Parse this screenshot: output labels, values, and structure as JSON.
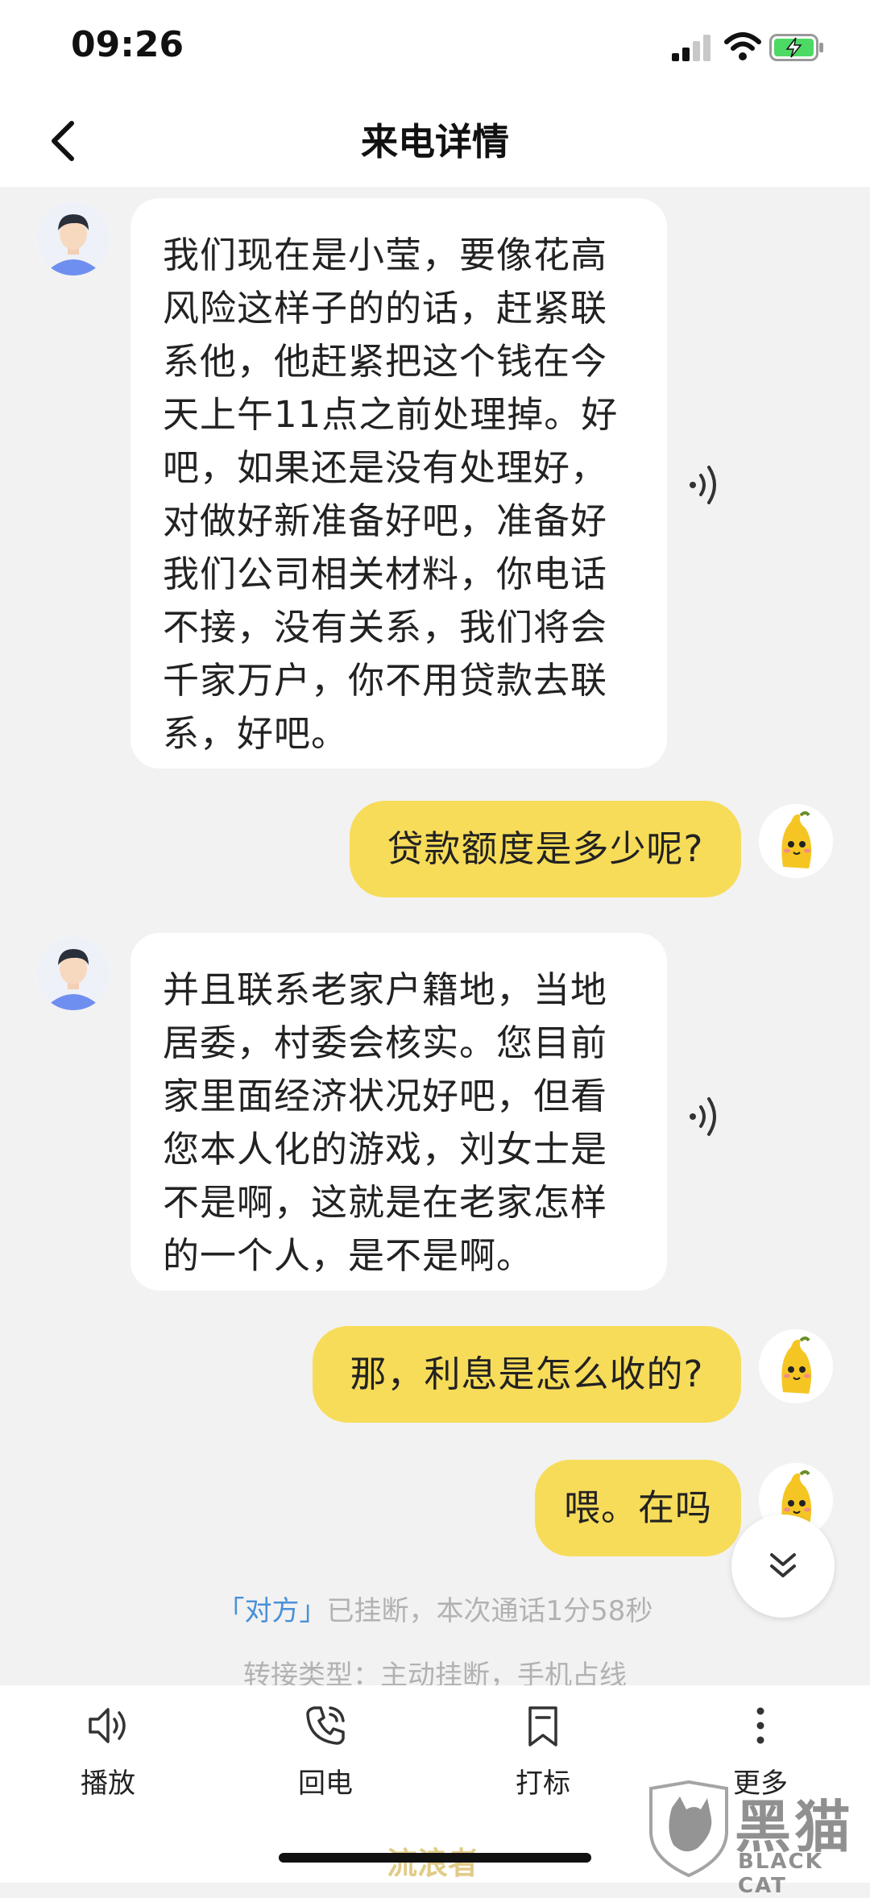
{
  "status_bar": {
    "time": "09:26"
  },
  "header": {
    "title": "来电详情",
    "back_icon": "chevron-left-icon"
  },
  "messages": [
    {
      "side": "left",
      "text": "我们现在是小莹，要像花高\n风险这样子的的话，赶紧联\n系他，他赶紧把这个钱在今\n天上午11点之前处理掉。好\n吧，如果还是没有处理好，\n对做好新准备好吧，准备好\n我们公司相关材料，你电话\n不接，没有关系，我们将会\n千家万户，你不用贷款去联\n系，好吧。"
    },
    {
      "side": "right",
      "text": "贷款额度是多少呢?"
    },
    {
      "side": "left",
      "text": "并且联系老家户籍地，当地\n居委，村委会核实。您目前\n家里面经济状况好吧，但看\n您本人化的游戏，刘女士是\n不是啊，这就是在老家怎样\n的一个人，是不是啊。"
    },
    {
      "side": "right",
      "text": "那，利息是怎么收的?"
    },
    {
      "side": "right",
      "text": "喂。在吗"
    }
  ],
  "call_status": {
    "party": "「对方」",
    "hangup_text": "已挂断，本次通话1分58秒",
    "transfer_text": "转接类型：主动挂断，手机占线"
  },
  "toolbar": [
    {
      "label": "播放",
      "icon": "speaker-icon"
    },
    {
      "label": "回电",
      "icon": "phone-icon"
    },
    {
      "label": "打标",
      "icon": "bookmark-icon"
    },
    {
      "label": "更多",
      "icon": "more-vertical-icon"
    }
  ],
  "watermark": {
    "text": "黑猫",
    "subtext": "BLACK CAT",
    "small": "流浪者"
  },
  "colors": {
    "bubble_right": "#f7dc5a",
    "bubble_left": "#ffffff",
    "background": "#f2f2f2",
    "link": "#4a90d9"
  }
}
